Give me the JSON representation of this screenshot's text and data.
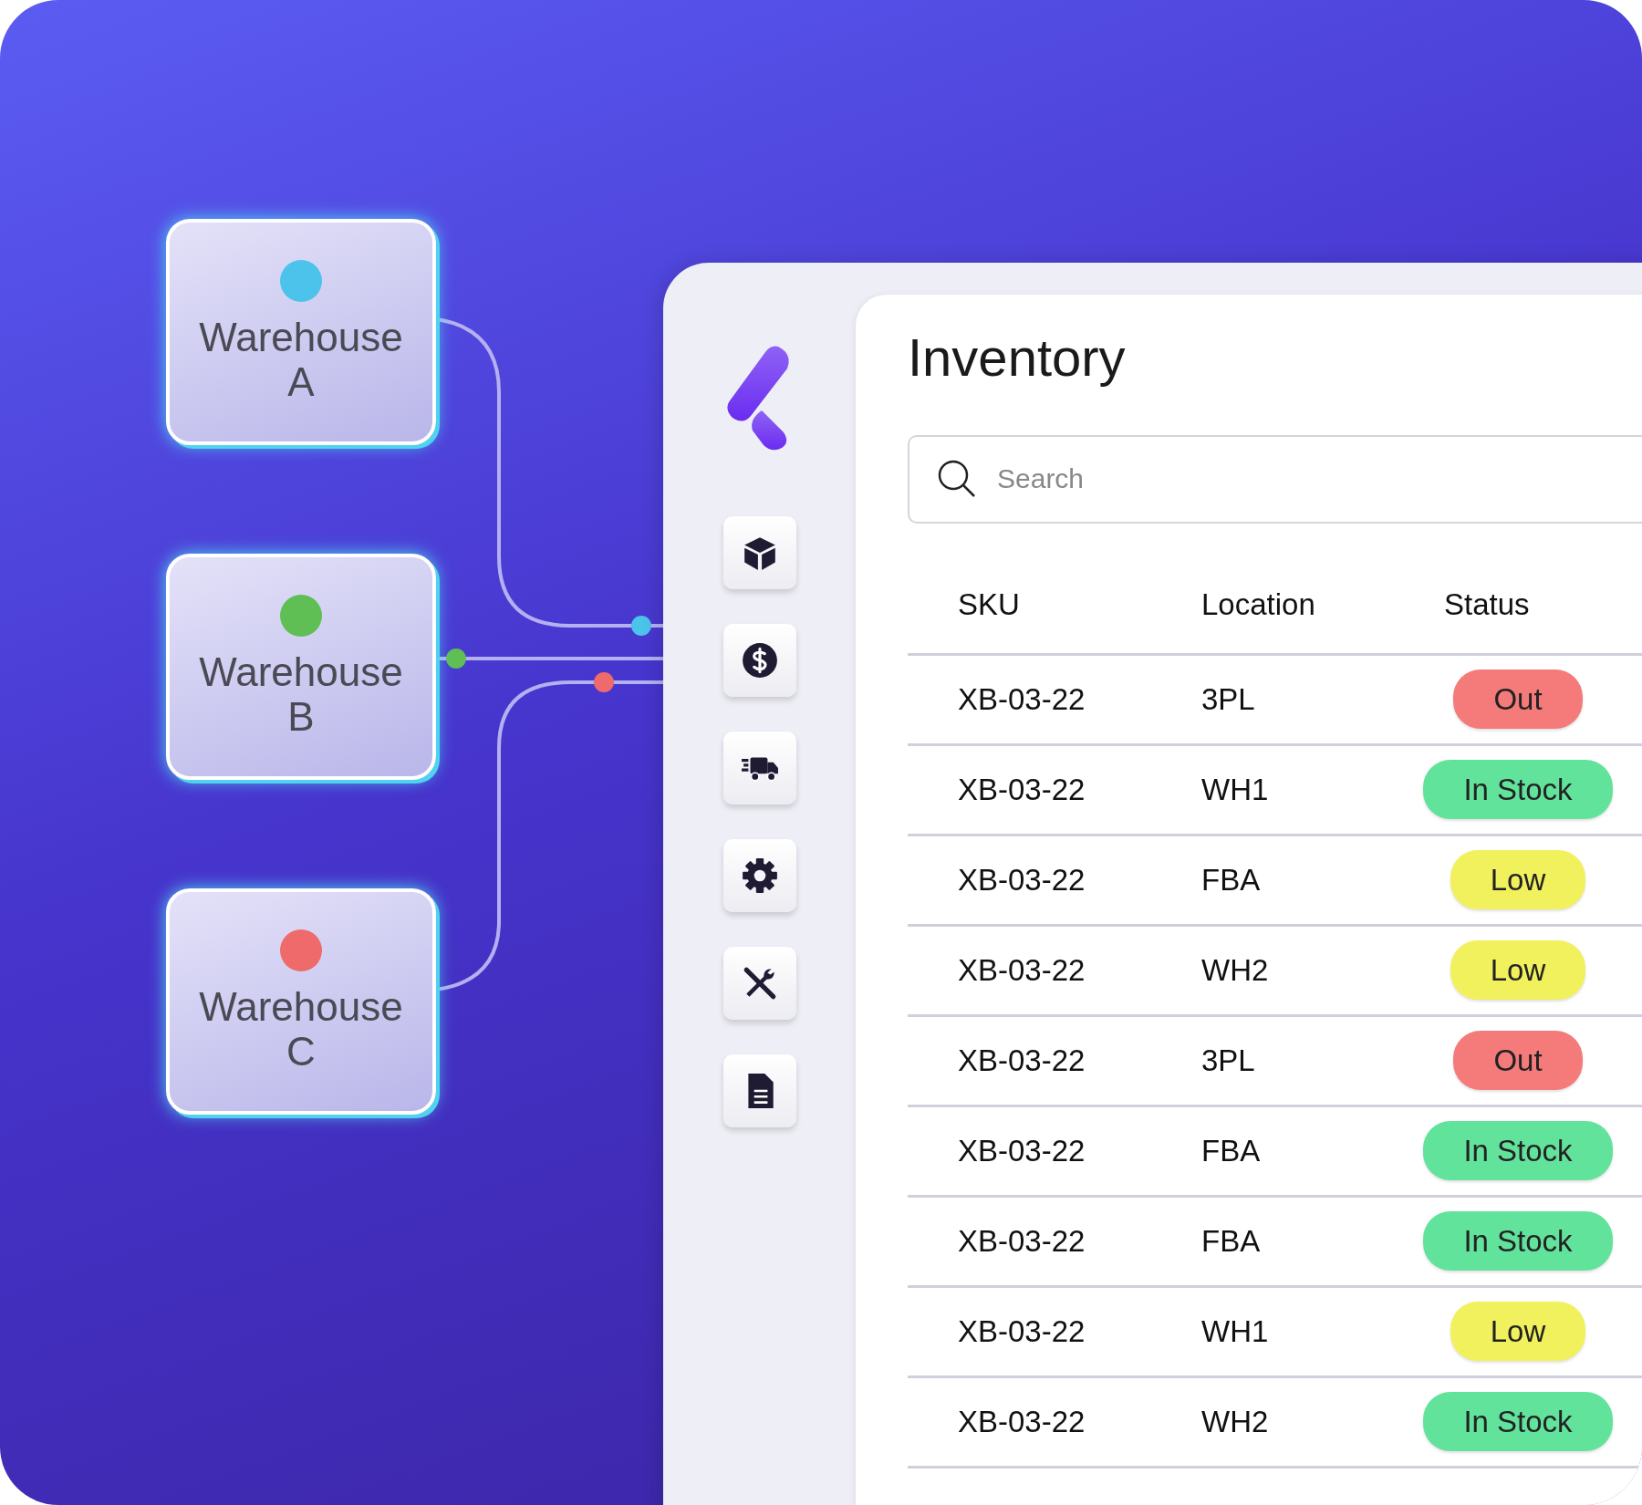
{
  "warehouses": [
    {
      "label": "Warehouse A",
      "color": "#4cc3ea"
    },
    {
      "label": "Warehouse B",
      "color": "#5fbf55"
    },
    {
      "label": "Warehouse C",
      "color": "#ef6a6a"
    }
  ],
  "sidebar": {
    "items": [
      {
        "kind": "cube"
      },
      {
        "kind": "dollar"
      },
      {
        "kind": "truck"
      },
      {
        "kind": "gear"
      },
      {
        "kind": "tools"
      },
      {
        "kind": "document"
      }
    ]
  },
  "title": "Inventory",
  "search": {
    "placeholder": "Search"
  },
  "table": {
    "columns": [
      "SKU",
      "Location",
      "Status"
    ],
    "rows": [
      {
        "sku": "XB-03-22",
        "location": "3PL",
        "status": "Out",
        "color": "#f57b7b"
      },
      {
        "sku": "XB-03-22",
        "location": "WH1",
        "status": "In Stock",
        "color": "#62e39c"
      },
      {
        "sku": "XB-03-22",
        "location": "FBA",
        "status": "Low",
        "color": "#f1f15e"
      },
      {
        "sku": "XB-03-22",
        "location": "WH2",
        "status": "Low",
        "color": "#f1f15e"
      },
      {
        "sku": "XB-03-22",
        "location": "3PL",
        "status": "Out",
        "color": "#f57b7b"
      },
      {
        "sku": "XB-03-22",
        "location": "FBA",
        "status": "In Stock",
        "color": "#62e39c"
      },
      {
        "sku": "XB-03-22",
        "location": "FBA",
        "status": "In Stock",
        "color": "#62e39c"
      },
      {
        "sku": "XB-03-22",
        "location": "WH1",
        "status": "Low",
        "color": "#f1f15e"
      },
      {
        "sku": "XB-03-22",
        "location": "WH2",
        "status": "In Stock",
        "color": "#62e39c"
      }
    ]
  }
}
